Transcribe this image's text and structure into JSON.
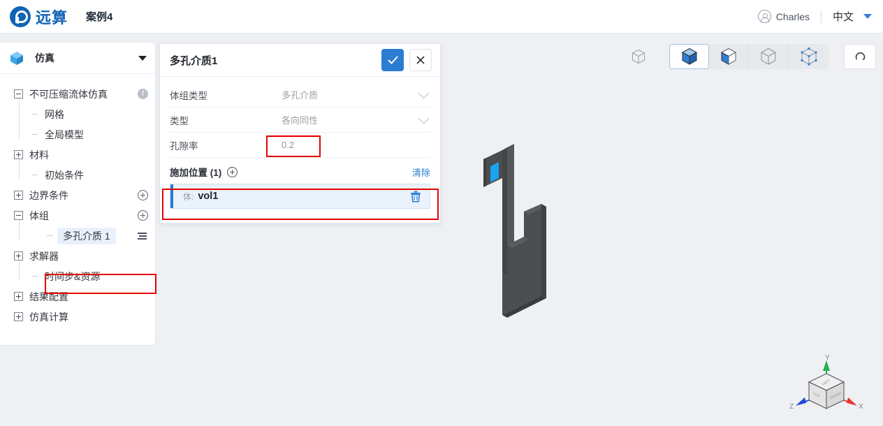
{
  "header": {
    "logo_text": "远算",
    "logo_icon": "rocket-logo-icon",
    "case_title": "案例4",
    "user_icon": "user-avatar-icon",
    "user_name": "Charles",
    "language": "中文",
    "language_caret_icon": "chevron-down-icon",
    "accent_color": "#1164b4"
  },
  "sidebar": {
    "module_icon": "cube-icon",
    "module_label": "仿真",
    "collapse_icon": "caret-down-icon",
    "tree": [
      {
        "label": "不可压缩流体仿真",
        "indent": 0,
        "toggle": "minus",
        "badge": "warning-icon",
        "selected": false
      },
      {
        "label": "网格",
        "indent": 1,
        "toggle": "leaf",
        "badge": "",
        "selected": false
      },
      {
        "label": "全局模型",
        "indent": 1,
        "toggle": "leaf",
        "badge": "",
        "selected": false
      },
      {
        "label": "材料",
        "indent": 0,
        "toggle": "plus",
        "badge": "",
        "selected": false
      },
      {
        "label": "初始条件",
        "indent": 1,
        "toggle": "leaf",
        "badge": "",
        "selected": false
      },
      {
        "label": "边界条件",
        "indent": 0,
        "toggle": "plus",
        "badge": "add-icon",
        "selected": false
      },
      {
        "label": "体组",
        "indent": 0,
        "toggle": "minus",
        "badge": "add-icon",
        "selected": false
      },
      {
        "label": "多孔介质 1",
        "indent": 2,
        "toggle": "leaf",
        "badge": "list-icon",
        "selected": true
      },
      {
        "label": "求解器",
        "indent": 0,
        "toggle": "plus",
        "badge": "",
        "selected": false
      },
      {
        "label": "时间步&资源",
        "indent": 1,
        "toggle": "leaf",
        "badge": "",
        "selected": false
      },
      {
        "label": "结果配置",
        "indent": 0,
        "toggle": "plus",
        "badge": "",
        "selected": false
      },
      {
        "label": "仿真计算",
        "indent": 0,
        "toggle": "plus",
        "badge": "",
        "selected": false
      }
    ]
  },
  "panel": {
    "title": "多孔介质1",
    "confirm_icon": "check-icon",
    "close_icon": "close-icon",
    "fields": [
      {
        "label": "体组类型",
        "value": "多孔介质",
        "control": "select",
        "highlighted": false
      },
      {
        "label": "类型",
        "value": "各向同性",
        "control": "select",
        "highlighted": false
      },
      {
        "label": "孔隙率",
        "value": "0.2",
        "control": "input",
        "highlighted": true
      }
    ],
    "section": {
      "title": "施加位置 (1)",
      "add_icon": "add-circle-icon",
      "clear_label": "清除",
      "items": [
        {
          "prefix": "体:",
          "name": "vol1",
          "delete_icon": "trash-icon"
        }
      ]
    },
    "highlight_color": "#e60000"
  },
  "viewport": {
    "toolbar": [
      {
        "icon": "wireframe-cube-icon",
        "name": "view-wireframe",
        "active": false,
        "grouped": false
      },
      {
        "icon": "solid-cube-icon",
        "name": "view-solid",
        "active": true,
        "grouped": true
      },
      {
        "icon": "solid-edges-cube-icon",
        "name": "view-solid-edges",
        "active": false,
        "grouped": true
      },
      {
        "icon": "outline-cube-icon",
        "name": "view-outline",
        "active": false,
        "grouped": true
      },
      {
        "icon": "points-cube-icon",
        "name": "view-points",
        "active": false,
        "grouped": true
      },
      {
        "icon": "reset-view-icon",
        "name": "reset-view",
        "active": false,
        "grouped": false
      }
    ],
    "model_name": "porous-media-geometry",
    "model_color": "#4a4a4a",
    "highlight_face_color": "#1aa3f0",
    "axes": {
      "x_label": "X",
      "y_label": "Y",
      "z_label": "Z",
      "x_color": "#e8352b",
      "y_color": "#21b24b",
      "z_color": "#2246d8",
      "cube_faces": [
        "TOP",
        "LEFT",
        "FRONT"
      ]
    },
    "background_color": "#eef0f4"
  }
}
